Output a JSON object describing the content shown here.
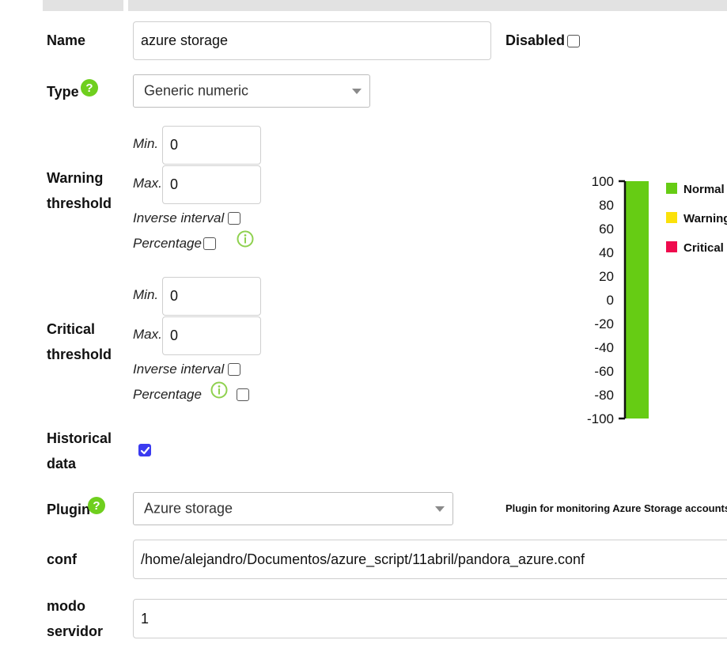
{
  "form": {
    "name": {
      "label": "Name",
      "value": "azure storage"
    },
    "disabled": {
      "label": "Disabled",
      "checked": false
    },
    "type": {
      "label": "Type",
      "selected": "Generic numeric"
    },
    "warning": {
      "label_line1": "Warning",
      "label_line2": "threshold",
      "min_label": "Min.",
      "min_value": "0",
      "max_label": "Max.",
      "max_value": "0",
      "inverse_label": "Inverse interval",
      "percentage_label": "Percentage"
    },
    "critical": {
      "label_line1": "Critical",
      "label_line2": "threshold",
      "min_label": "Min.",
      "min_value": "0",
      "max_label": "Max.",
      "max_value": "0",
      "inverse_label": "Inverse interval",
      "percentage_label": "Percentage"
    },
    "historical": {
      "label_line1": "Historical",
      "label_line2": "data",
      "checked": true
    },
    "plugin": {
      "label": "Plugin",
      "selected": "Azure storage",
      "description": "Plugin for monitoring Azure Storage accounts"
    },
    "conf": {
      "label": "conf",
      "value": "/home/alejandro/Documentos/azure_script/11abril/pandora_azure.conf"
    },
    "modo": {
      "label_line1": "modo",
      "label_line2": "servidor",
      "value": "1"
    }
  },
  "chart_data": {
    "type": "bar",
    "y_ticks": [
      "100",
      "80",
      "60",
      "40",
      "20",
      "0",
      "-20",
      "-40",
      "-60",
      "-80",
      "-100"
    ],
    "ylim": [
      -100,
      100
    ],
    "bands": [
      {
        "name": "Normal",
        "from": -100,
        "to": 100,
        "color": "#66cc14"
      }
    ],
    "legend": [
      {
        "name": "Normal",
        "color": "#66cc14"
      },
      {
        "name": "Warning",
        "color": "#fbe10a"
      },
      {
        "name": "Critical",
        "color": "#ef0a4d"
      }
    ],
    "legend_position": "right"
  },
  "colors": {
    "help_icon": "#6fcf1e",
    "info_icon": "#8fd14f",
    "checkbox_checked": "#3b3bf0"
  }
}
